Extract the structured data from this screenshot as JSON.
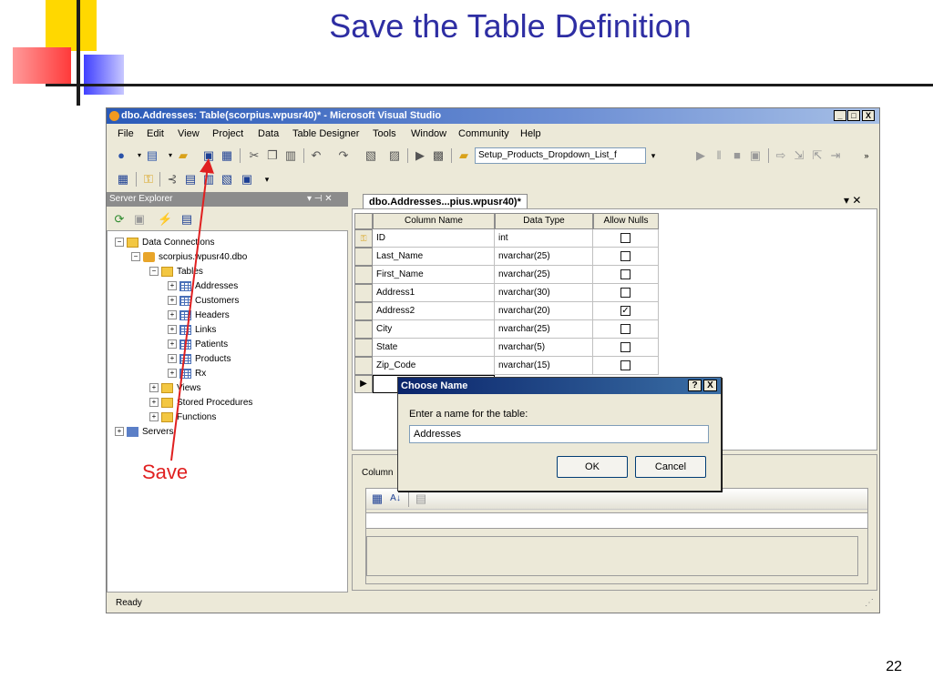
{
  "slide": {
    "title": "Save the Table Definition",
    "page_number": "22",
    "annotation_label": "Save",
    "annotation_color": "#e02020"
  },
  "window": {
    "title": "dbo.Addresses: Table(scorpius.wpusr40)* - Microsoft Visual Studio",
    "controls": [
      "_",
      "□",
      "X"
    ]
  },
  "menu": [
    "File",
    "Edit",
    "View",
    "Project",
    "Data",
    "Table Designer",
    "Tools",
    "Window",
    "Community",
    "Help"
  ],
  "toolbar": {
    "config_combo": "Setup_Products_Dropdown_List_f"
  },
  "server_explorer": {
    "title": "Server Explorer",
    "header_controls": "▾ ⊣ ✕",
    "tree": {
      "data_connections": "Data Connections",
      "connection": "scorpius.wpusr40.dbo",
      "tables": "Tables",
      "table_items": [
        "Addresses",
        "Customers",
        "Headers",
        "Links",
        "Patients",
        "Products",
        "Rx"
      ],
      "views": "Views",
      "stored_procedures": "Stored Procedures",
      "functions": "Functions",
      "servers": "Servers"
    }
  },
  "document": {
    "tab": "dbo.Addresses...pius.wpusr40)*",
    "tab_controls": "▾ ✕",
    "columns": [
      "Column Name",
      "Data Type",
      "Allow Nulls"
    ],
    "rows": [
      {
        "name": "ID",
        "type": "int",
        "nulls": false,
        "key": true
      },
      {
        "name": "Last_Name",
        "type": "nvarchar(25)",
        "nulls": false
      },
      {
        "name": "First_Name",
        "type": "nvarchar(25)",
        "nulls": false
      },
      {
        "name": "Address1",
        "type": "nvarchar(30)",
        "nulls": false
      },
      {
        "name": "Address2",
        "type": "nvarchar(20)",
        "nulls": true
      },
      {
        "name": "City",
        "type": "nvarchar(25)",
        "nulls": false
      },
      {
        "name": "State",
        "type": "nvarchar(5)",
        "nulls": false
      },
      {
        "name": "Zip_Code",
        "type": "nvarchar(15)",
        "nulls": false
      }
    ]
  },
  "properties": {
    "tab": "Column"
  },
  "status": "Ready",
  "dialog": {
    "title": "Choose Name",
    "help_button": "?",
    "close_button": "X",
    "prompt": "Enter a name for the table:",
    "value": "Addresses",
    "ok": "OK",
    "cancel": "Cancel"
  }
}
